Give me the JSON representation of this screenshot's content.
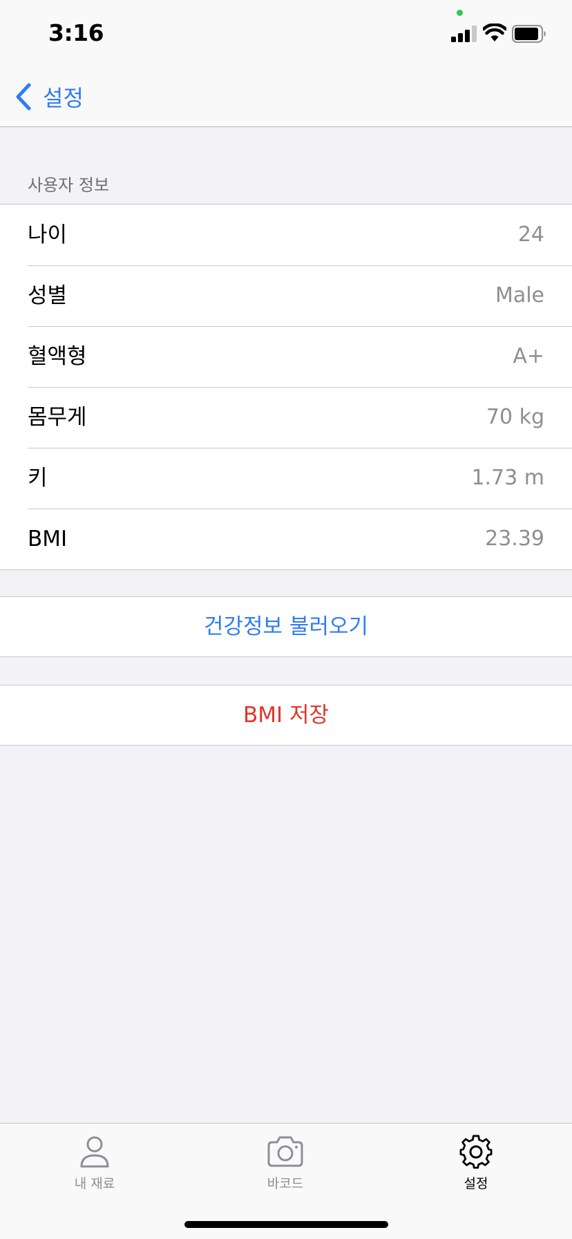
{
  "status_bar": {
    "time": "3:16"
  },
  "nav": {
    "back_label": "설정",
    "back_icon": "chevron-left-icon"
  },
  "section": {
    "header": "사용자 정보",
    "rows": [
      {
        "label": "나이",
        "value": "24"
      },
      {
        "label": "성별",
        "value": "Male"
      },
      {
        "label": "혈액형",
        "value": "A+"
      },
      {
        "label": "몸무게",
        "value": "70 kg"
      },
      {
        "label": "키",
        "value": "1.73 m"
      },
      {
        "label": "BMI",
        "value": "23.39"
      }
    ]
  },
  "actions": {
    "load_health": "건강정보 불러오기",
    "save_bmi": "BMI 저장"
  },
  "tabs": [
    {
      "label": "내 재료",
      "icon": "person-icon",
      "selected": false
    },
    {
      "label": "바코드",
      "icon": "camera-icon",
      "selected": false
    },
    {
      "label": "설정",
      "icon": "gear-icon",
      "selected": true
    }
  ],
  "colors": {
    "accent": "#2f7cf6",
    "destructive": "#e2342a",
    "secondary_text": "#8e8e93",
    "background": "#f2f2f7"
  }
}
